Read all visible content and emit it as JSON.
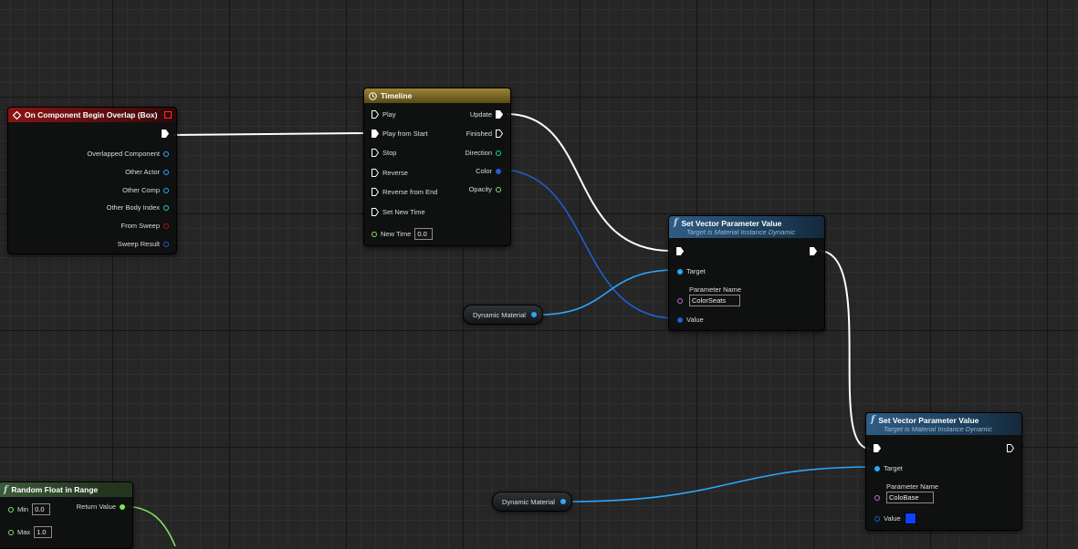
{
  "colors": {
    "exec_wire": "#ffffff",
    "object_wire": "#2aa8ff",
    "vector_wire": "#1f5fd1",
    "float_wire": "#7ee35a"
  },
  "overlap_event": {
    "title": "On Component Begin Overlap (Box)",
    "outputs": [
      "Overlapped Component",
      "Other Actor",
      "Other Comp",
      "Other Body Index",
      "From Sweep",
      "Sweep Result"
    ]
  },
  "timeline": {
    "title": "Timeline",
    "inputs": [
      "Play",
      "Play from Start",
      "Stop",
      "Reverse",
      "Reverse from End",
      "Set New Time"
    ],
    "new_time_label": "New Time",
    "new_time_value": "0.0",
    "outputs": [
      "Update",
      "Finished",
      "Direction",
      "Color",
      "Opacity"
    ]
  },
  "set_vector_1": {
    "title": "Set Vector Parameter Value",
    "subtitle": "Target is Material Instance Dynamic",
    "target_label": "Target",
    "param_label": "Parameter Name",
    "param_value": "ColorSeats",
    "value_label": "Value"
  },
  "set_vector_2": {
    "title": "Set Vector Parameter Value",
    "subtitle": "Target is Material Instance Dynamic",
    "target_label": "Target",
    "param_label": "Parameter Name",
    "param_value": "ColoBase",
    "value_label": "Value",
    "value_color": "#1040ff"
  },
  "dynamic_material_1": {
    "label": "Dynamic Material"
  },
  "dynamic_material_2": {
    "label": "Dynamic Material"
  },
  "random_float": {
    "title": "Random Float in Range",
    "min_label": "Min",
    "min_value": "0.0",
    "max_label": "Max",
    "max_value": "1.0",
    "output_label": "Return Value"
  }
}
